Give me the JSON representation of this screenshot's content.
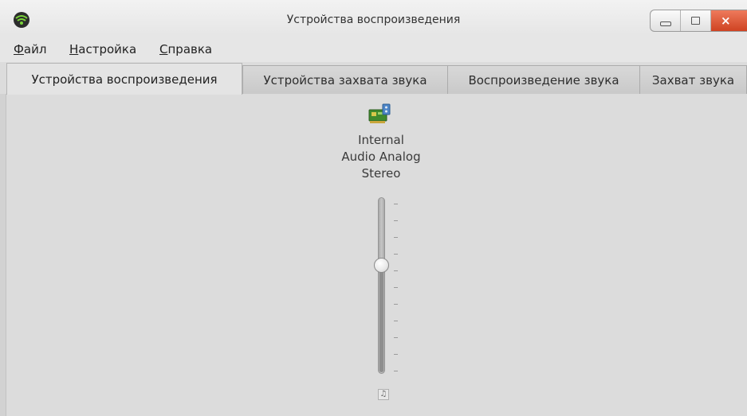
{
  "window": {
    "title": "Устройства воспроизведения",
    "icon": "speaker-waves-icon",
    "controls": {
      "minimize": "minimize-icon",
      "maximize": "maximize-icon",
      "close": "×"
    }
  },
  "menubar": [
    {
      "accel": "Ф",
      "rest": "айл"
    },
    {
      "accel": "Н",
      "rest": "астройка"
    },
    {
      "accel": "С",
      "rest": "правка"
    }
  ],
  "tabs": [
    {
      "label": "Устройства воспроизведения",
      "active": true
    },
    {
      "label": "Устройства захвата звука",
      "active": false
    },
    {
      "label": "Воспроизведение звука",
      "active": false
    },
    {
      "label": "Захват звука",
      "active": false
    }
  ],
  "device": {
    "icon": "sound-card-icon",
    "name_lines": [
      "Internal",
      "Audio Analog",
      "Stereo"
    ],
    "volume_fraction": 0.62,
    "mute_icon": "♫"
  },
  "colors": {
    "close_button": "#d9502f",
    "background": "#dcdcdc"
  }
}
